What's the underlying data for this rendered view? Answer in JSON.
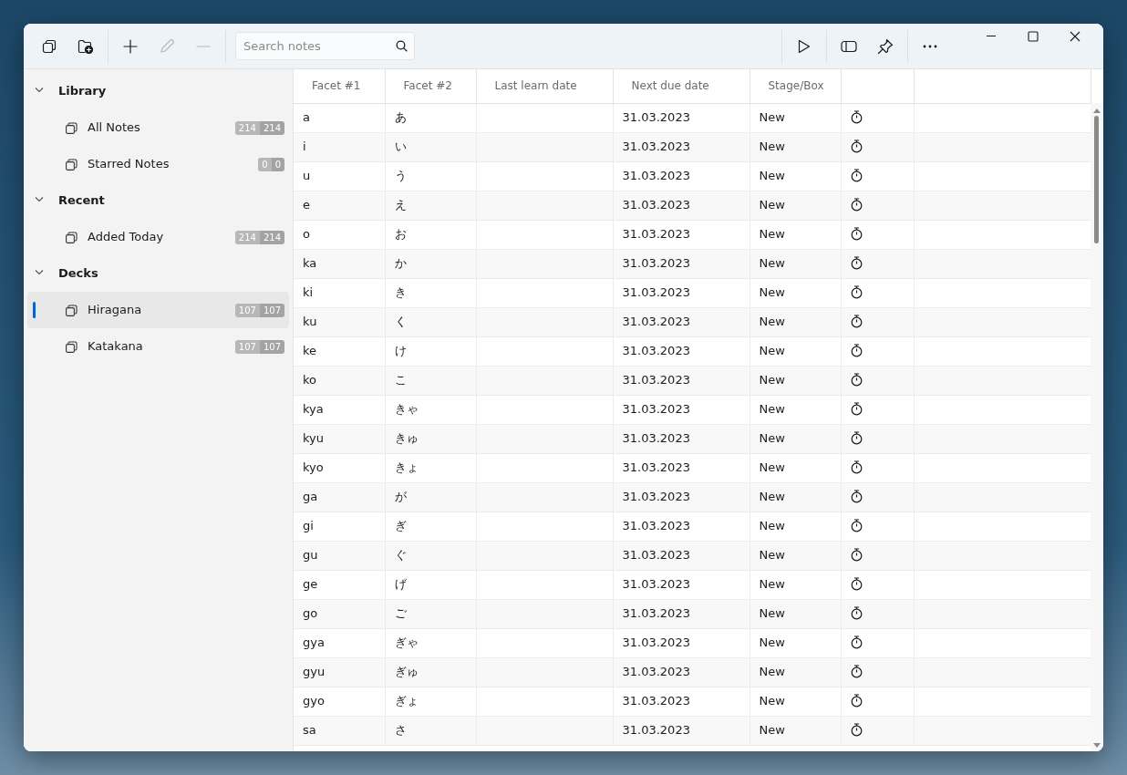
{
  "toolbar": {
    "left_groups": [
      [
        {
          "kind": "new-window",
          "disabled": false
        },
        {
          "kind": "new-folder",
          "disabled": false
        }
      ],
      [
        {
          "kind": "add",
          "disabled": false
        },
        {
          "kind": "edit",
          "disabled": true
        },
        {
          "kind": "remove",
          "disabled": true
        }
      ]
    ],
    "search": {
      "placeholder": "Search notes"
    },
    "right_groups": [
      [
        {
          "kind": "play",
          "disabled": false
        }
      ],
      [
        {
          "kind": "panel",
          "disabled": false
        },
        {
          "kind": "pin",
          "disabled": false
        }
      ],
      [
        {
          "kind": "more",
          "disabled": false
        }
      ]
    ]
  },
  "sidebar": {
    "sections": [
      {
        "title": "Library",
        "expanded": true,
        "items": [
          {
            "label": "All Notes",
            "counts": [
              "214",
              "214"
            ],
            "selected": false
          },
          {
            "label": "Starred Notes",
            "counts": [
              "0",
              "0"
            ],
            "selected": false
          }
        ]
      },
      {
        "title": "Recent",
        "expanded": true,
        "items": [
          {
            "label": "Added Today",
            "counts": [
              "214",
              "214"
            ],
            "selected": false
          }
        ]
      },
      {
        "title": "Decks",
        "expanded": true,
        "items": [
          {
            "label": "Hiragana",
            "counts": [
              "107",
              "107"
            ],
            "selected": true
          },
          {
            "label": "Katakana",
            "counts": [
              "107",
              "107"
            ],
            "selected": false
          }
        ]
      }
    ]
  },
  "table": {
    "columns": [
      "Facet #1",
      "Facet #2",
      "Last learn date",
      "Next due date",
      "Stage/Box"
    ],
    "rows": [
      {
        "facet_1": "a",
        "facet_2": "あ",
        "next_due_date": "31.03.2023",
        "stage": "New"
      },
      {
        "facet_1": "i",
        "facet_2": "い",
        "next_due_date": "31.03.2023",
        "stage": "New"
      },
      {
        "facet_1": "u",
        "facet_2": "う",
        "next_due_date": "31.03.2023",
        "stage": "New"
      },
      {
        "facet_1": "e",
        "facet_2": "え",
        "next_due_date": "31.03.2023",
        "stage": "New"
      },
      {
        "facet_1": "o",
        "facet_2": "お",
        "next_due_date": "31.03.2023",
        "stage": "New"
      },
      {
        "facet_1": "ka",
        "facet_2": "か",
        "next_due_date": "31.03.2023",
        "stage": "New"
      },
      {
        "facet_1": "ki",
        "facet_2": "き",
        "next_due_date": "31.03.2023",
        "stage": "New"
      },
      {
        "facet_1": "ku",
        "facet_2": "く",
        "next_due_date": "31.03.2023",
        "stage": "New"
      },
      {
        "facet_1": "ke",
        "facet_2": "け",
        "next_due_date": "31.03.2023",
        "stage": "New"
      },
      {
        "facet_1": "ko",
        "facet_2": "こ",
        "next_due_date": "31.03.2023",
        "stage": "New"
      },
      {
        "facet_1": "kya",
        "facet_2": "きゃ",
        "next_due_date": "31.03.2023",
        "stage": "New"
      },
      {
        "facet_1": "kyu",
        "facet_2": "きゅ",
        "next_due_date": "31.03.2023",
        "stage": "New"
      },
      {
        "facet_1": "kyo",
        "facet_2": "きょ",
        "next_due_date": "31.03.2023",
        "stage": "New"
      },
      {
        "facet_1": "ga",
        "facet_2": "が",
        "next_due_date": "31.03.2023",
        "stage": "New"
      },
      {
        "facet_1": "gi",
        "facet_2": "ぎ",
        "next_due_date": "31.03.2023",
        "stage": "New"
      },
      {
        "facet_1": "gu",
        "facet_2": "ぐ",
        "next_due_date": "31.03.2023",
        "stage": "New"
      },
      {
        "facet_1": "ge",
        "facet_2": "げ",
        "next_due_date": "31.03.2023",
        "stage": "New"
      },
      {
        "facet_1": "go",
        "facet_2": "ご",
        "next_due_date": "31.03.2023",
        "stage": "New"
      },
      {
        "facet_1": "gya",
        "facet_2": "ぎゃ",
        "next_due_date": "31.03.2023",
        "stage": "New"
      },
      {
        "facet_1": "gyu",
        "facet_2": "ぎゅ",
        "next_due_date": "31.03.2023",
        "stage": "New"
      },
      {
        "facet_1": "gyo",
        "facet_2": "ぎょ",
        "next_due_date": "31.03.2023",
        "stage": "New"
      },
      {
        "facet_1": "sa",
        "facet_2": "さ",
        "next_due_date": "31.03.2023",
        "stage": "New"
      }
    ]
  }
}
